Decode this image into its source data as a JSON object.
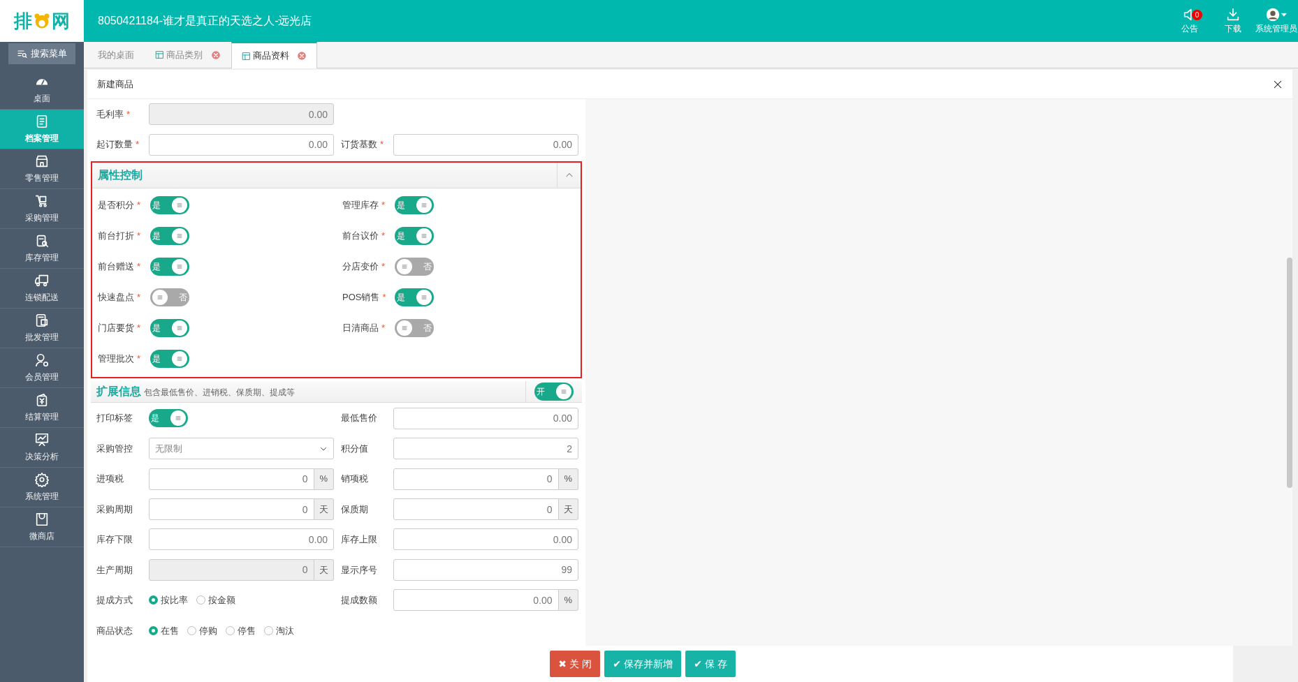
{
  "logo": {
    "left": "排",
    "right": "网"
  },
  "header": {
    "title": "8050421184-谁才是真正的天选之人-远光店",
    "actions": [
      {
        "kind": "notice",
        "label": "公告",
        "badge": "0"
      },
      {
        "kind": "download",
        "label": "下载"
      },
      {
        "kind": "user",
        "label": "系统管理员"
      }
    ]
  },
  "sidebar": {
    "search": "搜索菜单",
    "items": [
      {
        "label": "桌面",
        "selected": false
      },
      {
        "label": "档案管理",
        "selected": true
      },
      {
        "label": "零售管理",
        "selected": false
      },
      {
        "label": "采购管理",
        "selected": false
      },
      {
        "label": "库存管理",
        "selected": false
      },
      {
        "label": "连锁配送",
        "selected": false
      },
      {
        "label": "批发管理",
        "selected": false
      },
      {
        "label": "会员管理",
        "selected": false
      },
      {
        "label": "结算管理",
        "selected": false
      },
      {
        "label": "决策分析",
        "selected": false
      },
      {
        "label": "系统管理",
        "selected": false
      },
      {
        "label": "微商店",
        "selected": false
      }
    ]
  },
  "tabs": [
    {
      "label": "我的桌面",
      "selected": false,
      "closable": false
    },
    {
      "label": "商品类别",
      "selected": false,
      "closable": true
    },
    {
      "label": "商品资料",
      "selected": true,
      "closable": true
    }
  ],
  "panel": {
    "title": "新建商品"
  },
  "top_rows": [
    [
      {
        "kind": "input",
        "label": "毛利率",
        "mark": "*",
        "value": "0.00",
        "disabled": true
      }
    ],
    [
      {
        "kind": "input",
        "label": "起订数量",
        "mark": "*",
        "value": "0.00",
        "disabled": false
      },
      {
        "kind": "input",
        "label": "订货基数",
        "mark": "*",
        "value": "0.00",
        "disabled": false
      }
    ]
  ],
  "attributes": {
    "title": "属性控制",
    "expanded": true,
    "rows": [
      [
        {
          "kind": "toggle",
          "label": "是否积分",
          "mark": "*",
          "on": true,
          "text": "是"
        },
        {
          "kind": "toggle",
          "label": "管理库存",
          "mark": "*",
          "on": true,
          "text": "是"
        }
      ],
      [
        {
          "kind": "toggle",
          "label": "前台打折",
          "mark": "*",
          "on": true,
          "text": "是"
        },
        {
          "kind": "toggle",
          "label": "前台议价",
          "mark": "*",
          "on": true,
          "text": "是"
        }
      ],
      [
        {
          "kind": "toggle",
          "label": "前台赠送",
          "mark": "*",
          "on": true,
          "text": "是"
        },
        {
          "kind": "toggle",
          "label": "分店变价",
          "mark": "*",
          "on": false,
          "text": "否"
        }
      ],
      [
        {
          "kind": "toggle",
          "label": "快速盘点",
          "mark": "*",
          "on": false,
          "text": "否"
        },
        {
          "kind": "toggle",
          "label": "POS销售",
          "mark": "*",
          "on": true,
          "text": "是"
        }
      ],
      [
        {
          "kind": "toggle",
          "label": "门店要货",
          "mark": "*",
          "on": true,
          "text": "是"
        },
        {
          "kind": "toggle",
          "label": "日清商品",
          "mark": "*",
          "on": false,
          "text": "否"
        }
      ],
      [
        {
          "kind": "toggle",
          "label": "管理批次",
          "mark": "*",
          "on": true,
          "text": "是"
        }
      ]
    ]
  },
  "extended": {
    "title": "扩展信息",
    "subtitle": "包含最低售价、进销税、保质期、提成等",
    "switch": {
      "on": true,
      "text": "开"
    },
    "rows": [
      [
        {
          "kind": "toggle",
          "label": "打印标签",
          "on": true,
          "text": "是"
        },
        {
          "kind": "input",
          "label": "最低售价",
          "value": "0.00",
          "disabled": false
        }
      ],
      [
        {
          "kind": "select",
          "label": "采购管控",
          "value": "无限制"
        },
        {
          "kind": "input",
          "label": "积分值",
          "value": "2",
          "disabled": false
        }
      ],
      [
        {
          "kind": "addon",
          "label": "进项税",
          "value": "0",
          "unit": "%",
          "disabled": false
        },
        {
          "kind": "addon",
          "label": "销项税",
          "value": "0",
          "unit": "%",
          "disabled": false
        }
      ],
      [
        {
          "kind": "addon",
          "label": "采购周期",
          "value": "0",
          "unit": "天",
          "disabled": false
        },
        {
          "kind": "addon",
          "label": "保质期",
          "value": "0",
          "unit": "天",
          "disabled": false
        }
      ],
      [
        {
          "kind": "input",
          "label": "库存下限",
          "value": "0.00",
          "disabled": false
        },
        {
          "kind": "input",
          "label": "库存上限",
          "value": "0.00",
          "disabled": false
        }
      ],
      [
        {
          "kind": "addon",
          "label": "生产周期",
          "value": "0",
          "unit": "天",
          "disabled": true
        },
        {
          "kind": "input",
          "label": "显示序号",
          "value": "99",
          "disabled": false
        }
      ],
      [
        {
          "kind": "radio",
          "label": "提成方式",
          "options": [
            {
              "label": "按比率",
              "selected": true
            },
            {
              "label": "按金额",
              "selected": false
            }
          ]
        },
        {
          "kind": "addon",
          "label": "提成数额",
          "value": "0.00",
          "unit": "%",
          "disabled": false
        }
      ],
      [
        {
          "kind": "radio",
          "label": "商品状态",
          "options": [
            {
              "label": "在售",
              "selected": true
            },
            {
              "label": "停购",
              "selected": false
            },
            {
              "label": "停售",
              "selected": false
            },
            {
              "label": "淘汰",
              "selected": false
            }
          ]
        }
      ]
    ]
  },
  "footer": {
    "buttons": [
      {
        "kind": "close",
        "label": "关 闭",
        "icon": "✖"
      },
      {
        "kind": "save_new",
        "label": "保存并新增",
        "icon": "✔"
      },
      {
        "kind": "save",
        "label": "保 存",
        "icon": "✔"
      }
    ]
  }
}
